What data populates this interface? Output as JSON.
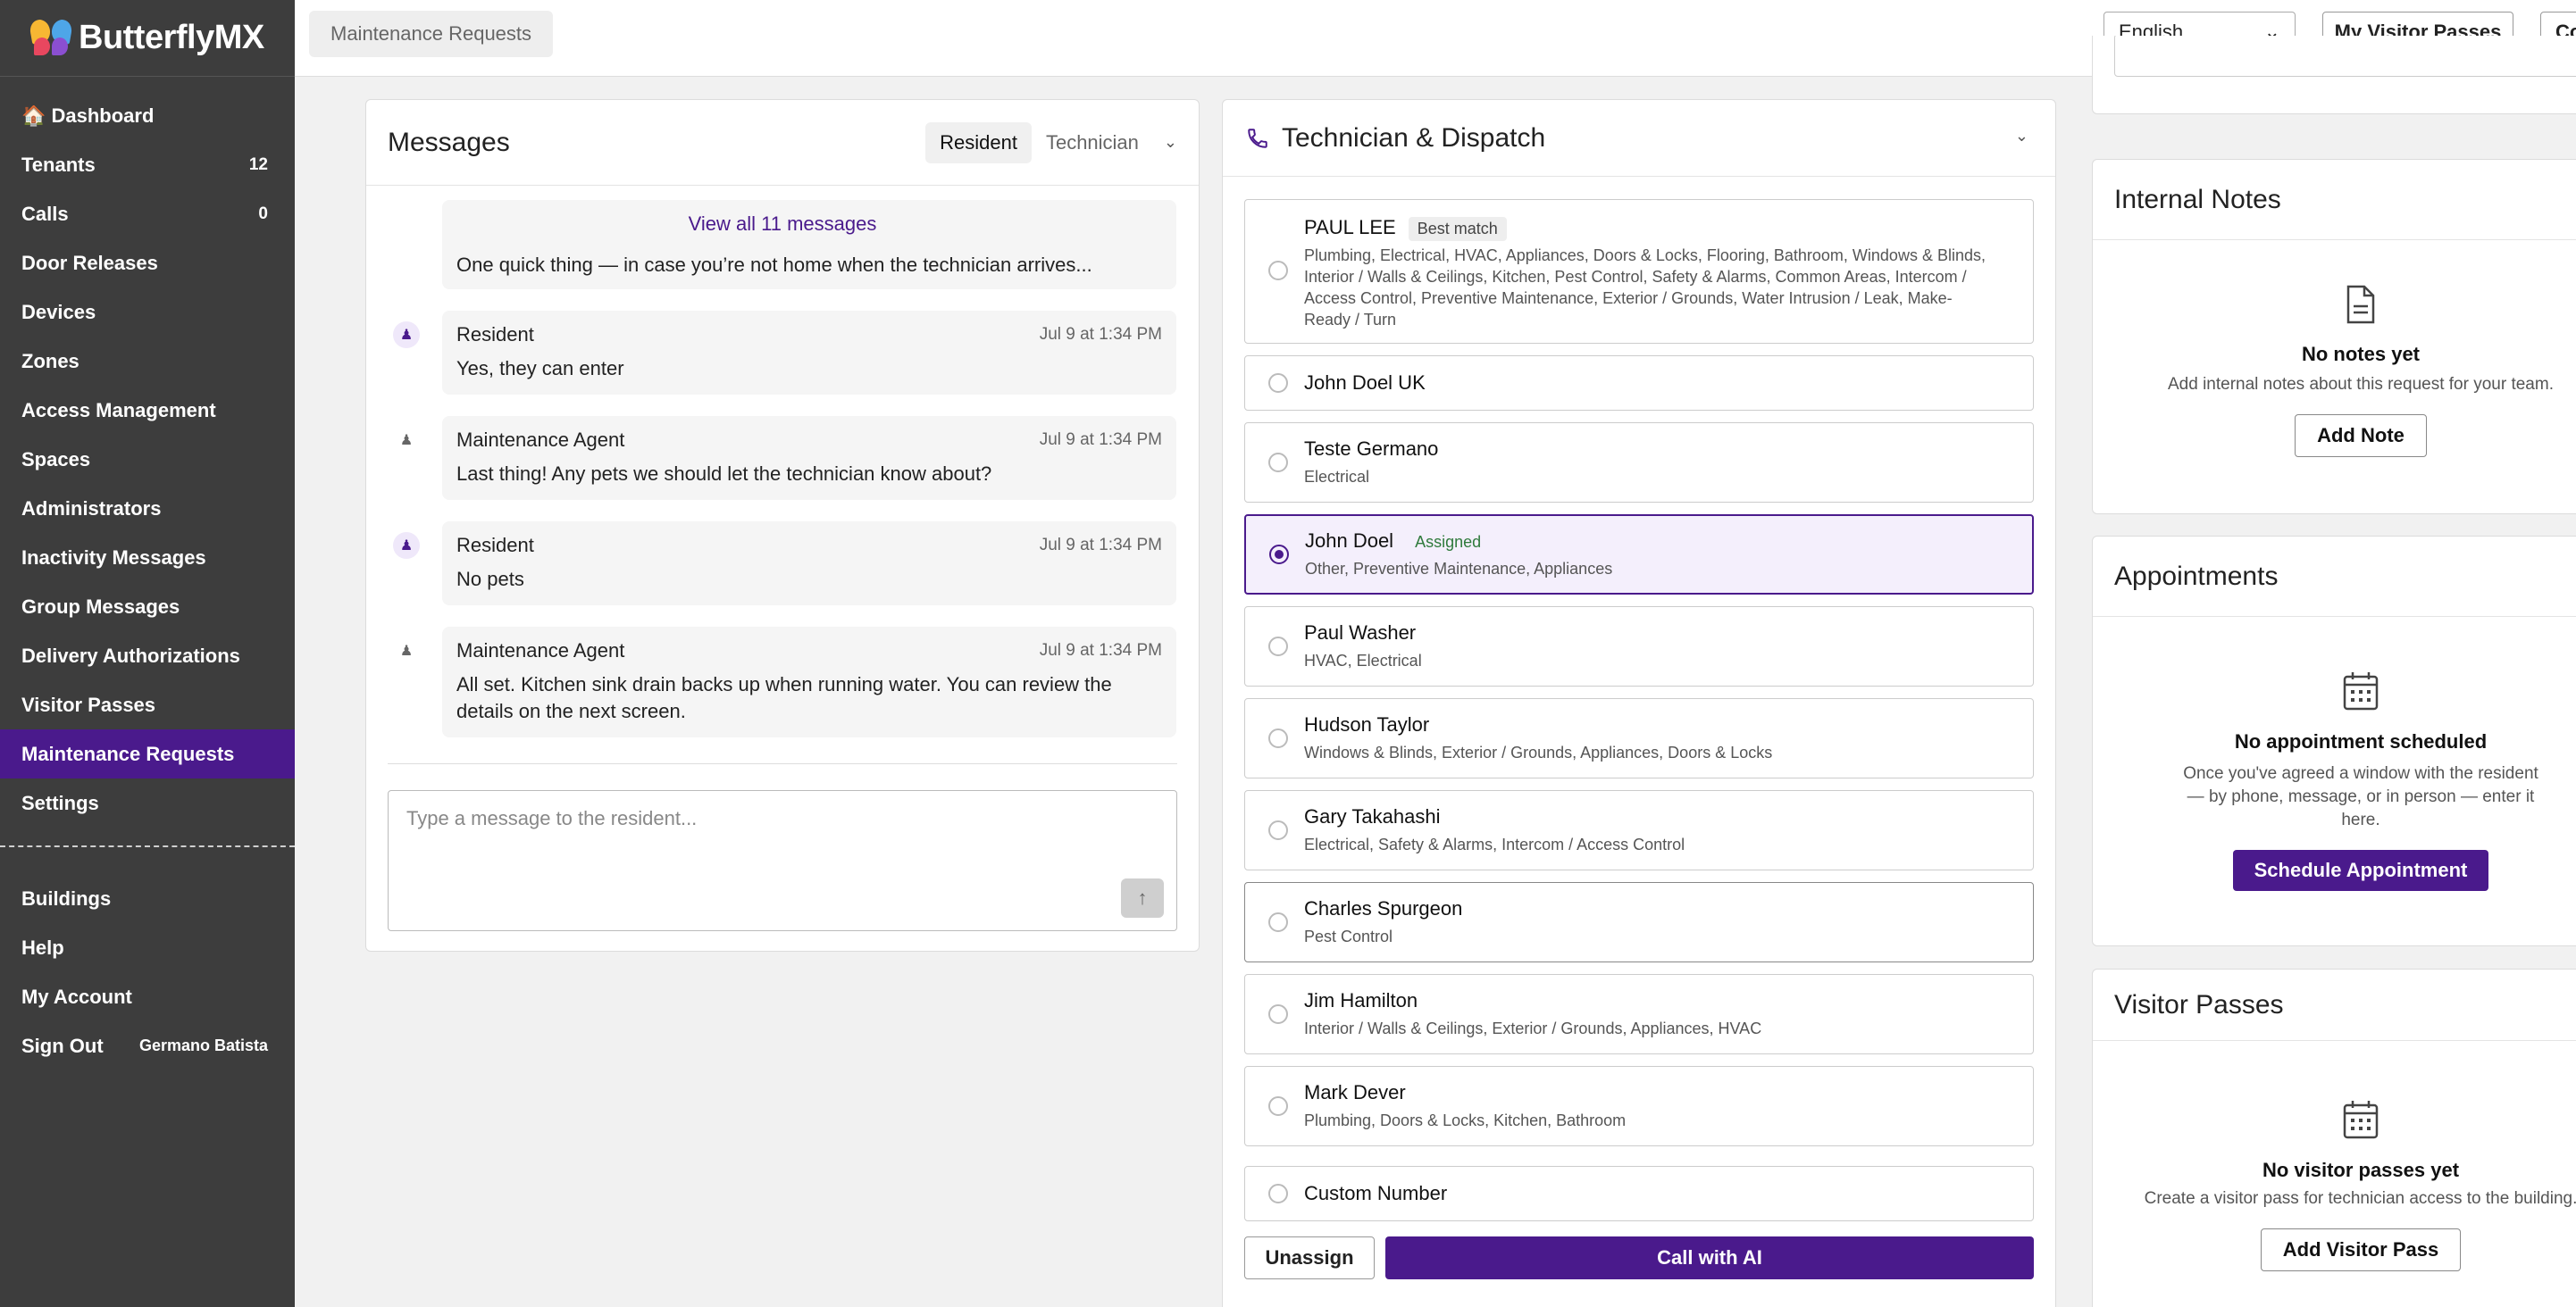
{
  "brand": {
    "name": "ButterflyMX"
  },
  "sidebar": {
    "items": [
      {
        "label": "🏠 Dashboard",
        "count": ""
      },
      {
        "label": "Tenants",
        "count": "12"
      },
      {
        "label": "Calls",
        "count": "0"
      },
      {
        "label": "Door Releases",
        "count": ""
      },
      {
        "label": "Devices",
        "count": ""
      },
      {
        "label": "Zones",
        "count": ""
      },
      {
        "label": "Access Management",
        "count": ""
      },
      {
        "label": "Spaces",
        "count": ""
      },
      {
        "label": "Administrators",
        "count": ""
      },
      {
        "label": "Inactivity Messages",
        "count": ""
      },
      {
        "label": "Group Messages",
        "count": ""
      },
      {
        "label": "Delivery Authorizations",
        "count": ""
      },
      {
        "label": "Visitor Passes",
        "count": ""
      },
      {
        "label": "Maintenance Requests",
        "count": ""
      },
      {
        "label": "Settings",
        "count": ""
      }
    ],
    "bottom": [
      {
        "label": "Buildings"
      },
      {
        "label": "Help"
      },
      {
        "label": "My Account"
      }
    ],
    "signout": {
      "label": "Sign Out",
      "user": "Germano Batista"
    },
    "active": "Maintenance Requests"
  },
  "topbar": {
    "breadcrumb": "Maintenance Requests",
    "language": "English",
    "visitor_passes": "My Visitor Passes",
    "cut_button": "Co"
  },
  "messages": {
    "title": "Messages",
    "tabs": [
      "Resident",
      "Technician"
    ],
    "view_all": "View all 11 messages",
    "items": [
      {
        "sender": "",
        "time": "",
        "text": "One quick thing — in case you’re not home when the technician arrives...",
        "role": "agent"
      },
      {
        "sender": "Resident",
        "time": "Jul 9 at 1:34 PM",
        "text": "Yes, they can enter",
        "role": "resident"
      },
      {
        "sender": "Maintenance Agent",
        "time": "Jul 9 at 1:34 PM",
        "text": "Last thing! Any pets we should let the technician know about?",
        "role": "agent"
      },
      {
        "sender": "Resident",
        "time": "Jul 9 at 1:34 PM",
        "text": "No pets",
        "role": "resident"
      },
      {
        "sender": "Maintenance Agent",
        "time": "Jul 9 at 1:34 PM",
        "text": "All set. Kitchen sink drain backs up when running water. You can review the details on the next screen.",
        "role": "agent"
      }
    ],
    "compose_placeholder": "Type a message to the resident..."
  },
  "dispatch": {
    "title": "Technician & Dispatch",
    "technicians": [
      {
        "name": "PAUL LEE",
        "badge": "Best match",
        "skills": "Plumbing, Electrical, HVAC, Appliances, Doors & Locks, Flooring, Bathroom, Windows & Blinds, Interior / Walls & Ceilings, Kitchen, Pest Control, Safety & Alarms, Common Areas, Intercom / Access Control, Preventive Maintenance, Exterior / Grounds, Water Intrusion / Leak, Make-Ready / Turn"
      },
      {
        "name": "John Doel UK",
        "badge": "",
        "skills": ""
      },
      {
        "name": "Teste Germano",
        "badge": "",
        "skills": "Electrical"
      },
      {
        "name": "John Doel",
        "badge": "Assigned",
        "skills": "Other, Preventive Maintenance, Appliances"
      },
      {
        "name": "Paul Washer",
        "badge": "",
        "skills": "HVAC, Electrical"
      },
      {
        "name": "Hudson Taylor",
        "badge": "",
        "skills": "Windows & Blinds, Exterior / Grounds, Appliances, Doors & Locks"
      },
      {
        "name": "Gary Takahashi",
        "badge": "",
        "skills": "Electrical, Safety & Alarms, Intercom / Access Control"
      },
      {
        "name": "Charles Spurgeon",
        "badge": "",
        "skills": "Pest Control"
      },
      {
        "name": "Jim Hamilton",
        "badge": "",
        "skills": "Interior / Walls & Ceilings, Exterior / Grounds, Appliances, HVAC"
      },
      {
        "name": "Mark Dever",
        "badge": "",
        "skills": "Plumbing, Doors & Locks, Kitchen, Bathroom"
      },
      {
        "name": "Custom Number",
        "badge": "",
        "skills": ""
      }
    ],
    "unassign": "Unassign",
    "call_ai": "Call with AI"
  },
  "notes": {
    "title": "Internal Notes",
    "empty_title": "No notes yet",
    "empty_text": "Add internal notes about this request for your team.",
    "button": "Add Note"
  },
  "appointments": {
    "title": "Appointments",
    "empty_title": "No appointment scheduled",
    "empty_text": "Once you've agreed a window with the resident — by phone, message, or in person — enter it here.",
    "button": "Schedule Appointment"
  },
  "visitor_passes": {
    "title": "Visitor Passes",
    "empty_title": "No visitor passes yet",
    "empty_text": "Create a visitor pass for technician access to the building.",
    "button": "Add Visitor Pass"
  },
  "colors": {
    "accent": "#4a1a8c",
    "sidebar": "#3d3d3d",
    "assigned": "#2f7a3c"
  }
}
